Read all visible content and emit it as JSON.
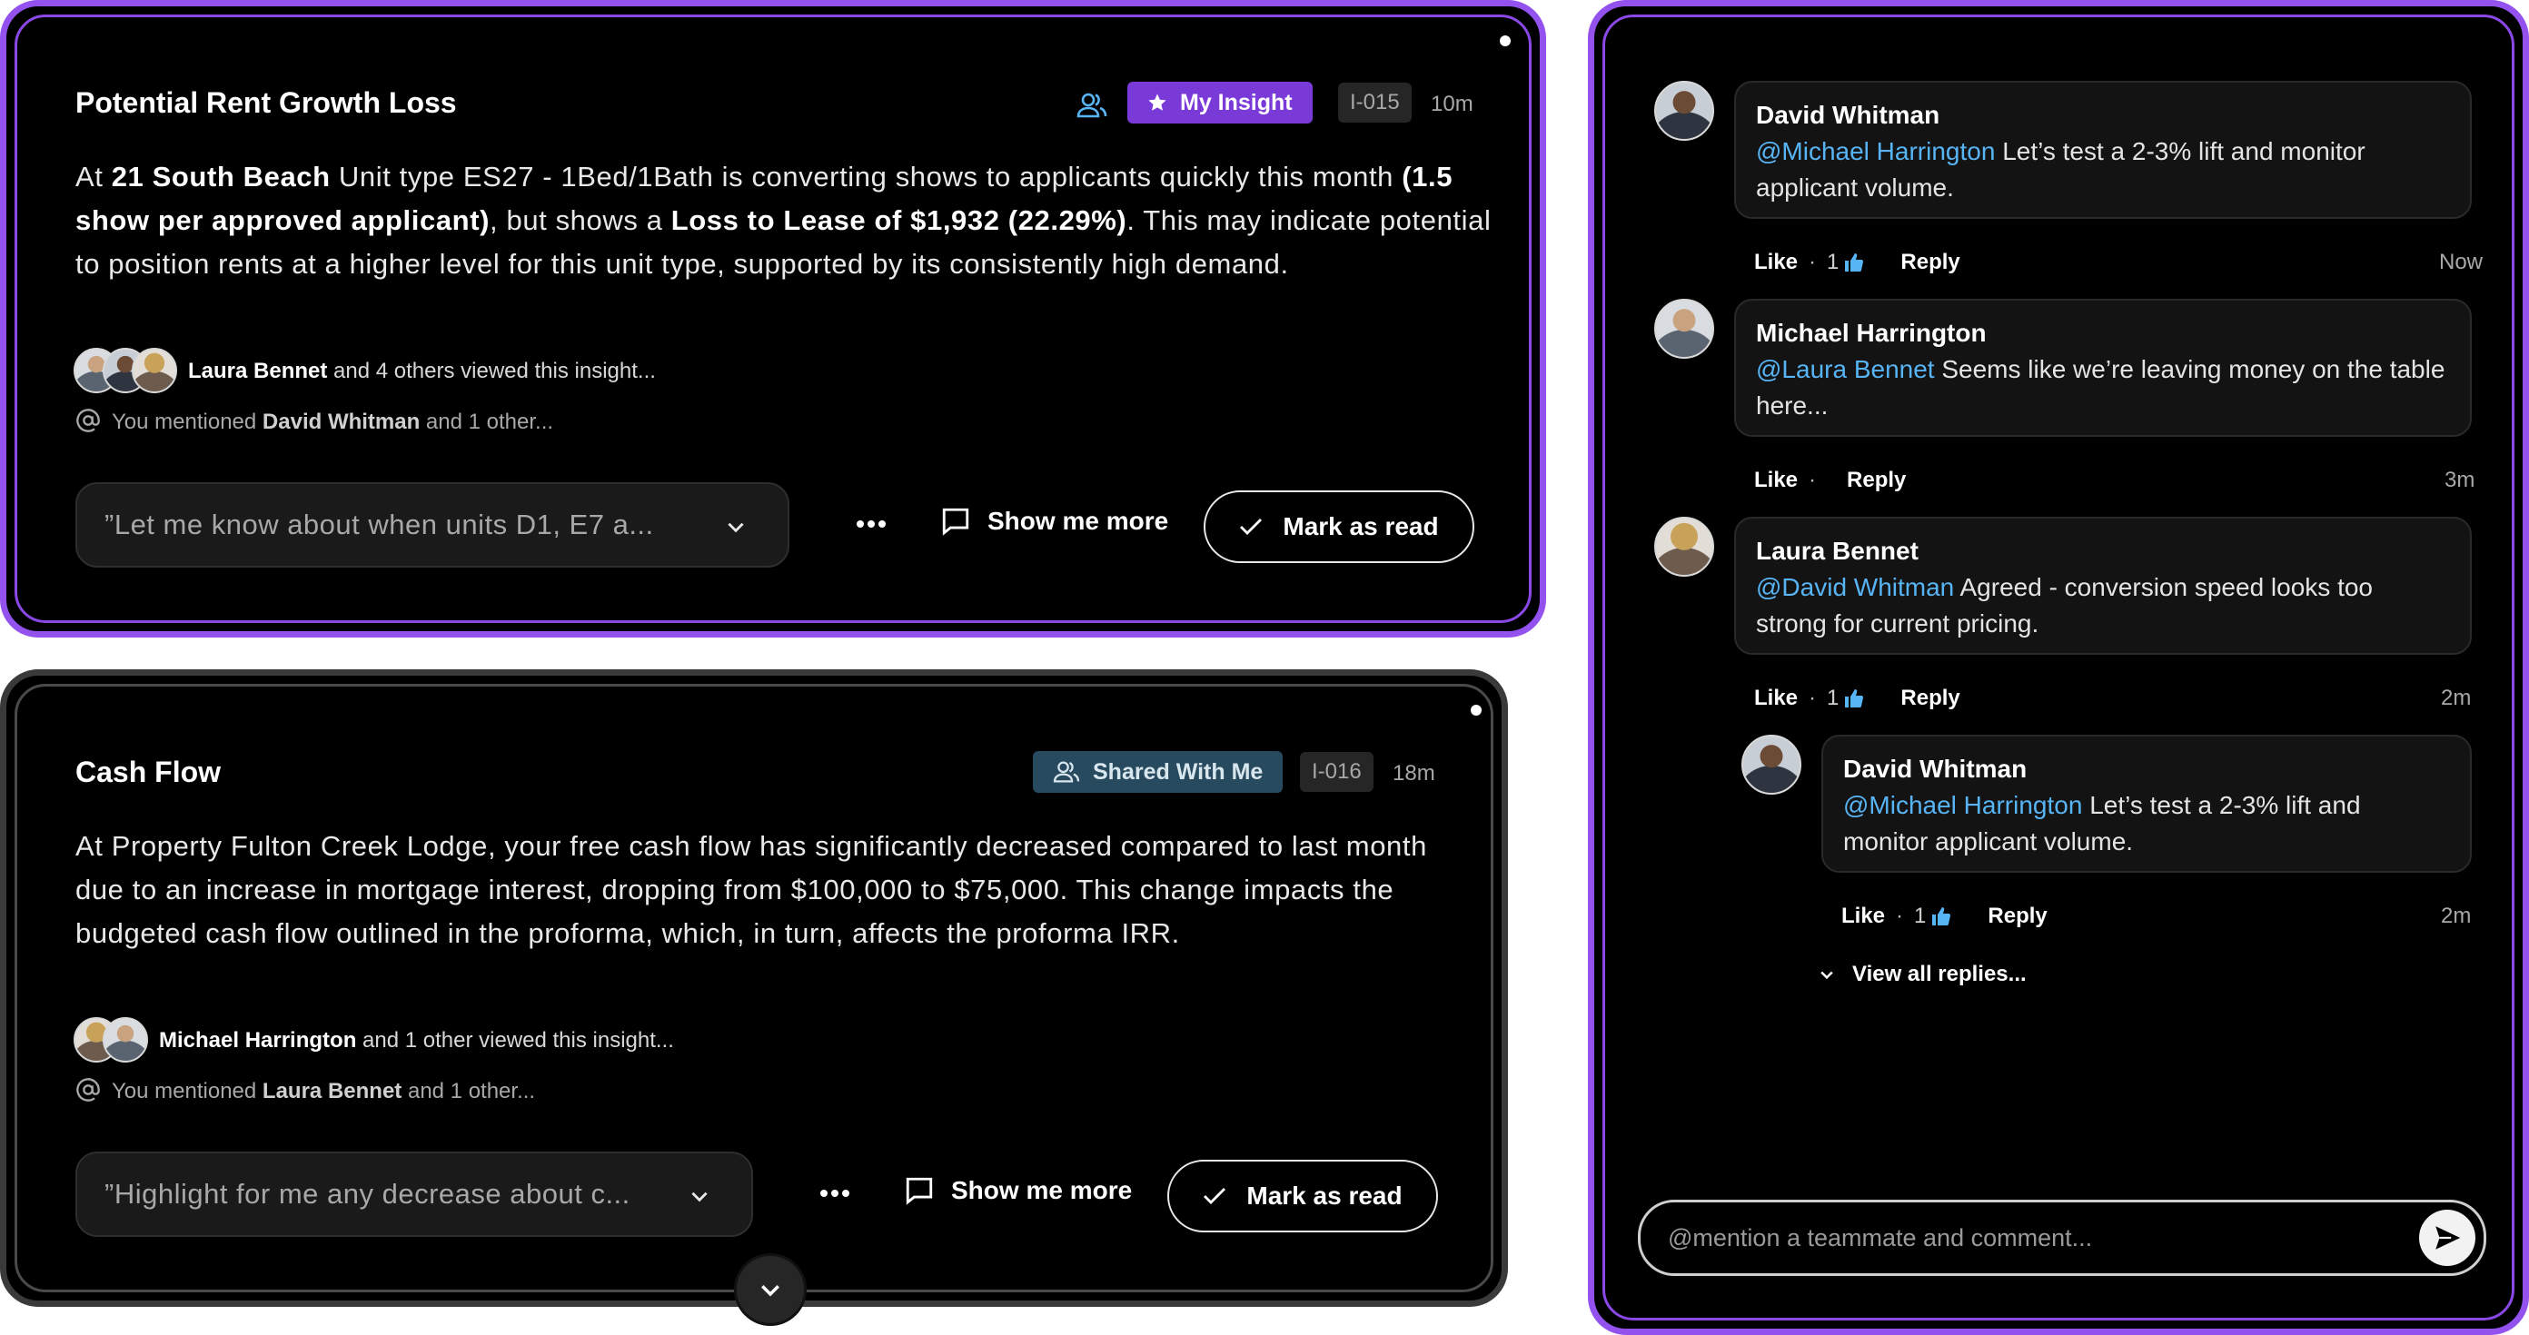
{
  "insights": [
    {
      "title": "Potential Rent Growth Loss",
      "badge": "My Insight",
      "id": "I-015",
      "age": "10m",
      "body": {
        "p1": "At ",
        "b1": "21 South Beach",
        "p2": " Unit type ES27 - 1Bed/1Bath is converting shows to applicants quickly this month ",
        "b2": "(1.5 show per approved applicant)",
        "p3": ", but shows a ",
        "b3": "Loss to Lease of $1,932 (22.29%)",
        "p4": ". This may indicate potential to position rents at a higher level for this unit type, supported by its consistently high demand."
      },
      "viewers_name": "Laura Bennet",
      "viewers_rest": " and 4 others viewed this insight...",
      "mention_prefix": "You mentioned ",
      "mention_name": "David Whitman",
      "mention_rest": " and 1 other...",
      "prompt": "”Let me know about when units D1, E7 a...",
      "show_more": "Show me more",
      "mark_read": "Mark as read"
    },
    {
      "title": "Cash Flow",
      "badge": "Shared With Me",
      "id": "I-016",
      "age": "18m",
      "body_text": "At Property Fulton Creek Lodge, your free cash flow has significantly decreased compared to last month due to an increase in mortgage interest, dropping from $100,000 to $75,000. This change impacts the budgeted cash flow outlined in the proforma, which, in turn, affects the proforma IRR.",
      "viewers_name": "Michael Harrington",
      "viewers_rest": " and 1 other viewed this insight...",
      "mention_prefix": "You mentioned ",
      "mention_name": "Laura Bennet",
      "mention_rest": " and 1 other...",
      "prompt": "”Highlight for me any decrease about c...",
      "show_more": "Show me more",
      "mark_read": "Mark as read"
    }
  ],
  "comments": [
    {
      "author": "David Whitman",
      "mention": "@Michael Harrington",
      "text": " Let’s test a 2-3% lift and monitor applicant volume.",
      "like": "Like",
      "like_count": "1",
      "reply": "Reply",
      "time": "Now"
    },
    {
      "author": "Michael Harrington",
      "mention": "@Laura Bennet",
      "text": " Seems like we’re leaving money on the table here...",
      "like": "Like",
      "reply": "Reply",
      "time": "3m"
    },
    {
      "author": "Laura Bennet",
      "mention": "@David Whitman",
      "text": " Agreed - conversion speed looks too strong for current pricing.",
      "like": "Like",
      "like_count": "1",
      "reply": "Reply",
      "time": "2m"
    },
    {
      "author": "David Whitman",
      "mention": "@Michael Harrington",
      "text": " Let’s test a 2-3% lift and monitor applicant volume.",
      "like": "Like",
      "like_count": "1",
      "reply": "Reply",
      "time": "2m"
    }
  ],
  "view_all_replies": "View all replies...",
  "comment_placeholder": "@mention a teammate and comment...",
  "colors": {
    "accent_purple": "#9352ee",
    "mention_blue": "#57b4f5",
    "shared_badge": "#284a5e"
  }
}
